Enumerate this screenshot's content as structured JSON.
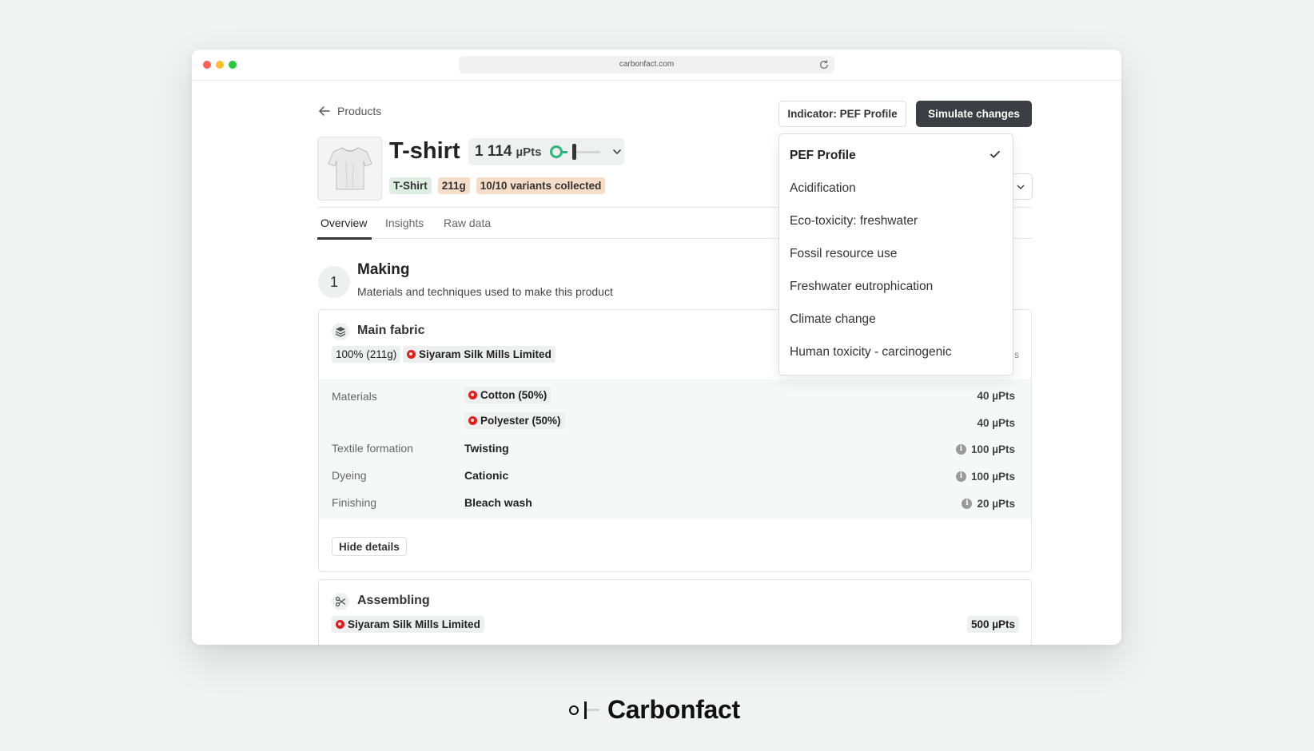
{
  "browser": {
    "url": "carbonfact.com"
  },
  "nav": {
    "back_label": "Products"
  },
  "toolbar": {
    "indicator_label": "Indicator: PEF Profile",
    "simulate_label": "Simulate changes"
  },
  "product": {
    "title": "T-shirt",
    "score": "1 114",
    "score_unit": "µPts",
    "score_level": 0.35,
    "tags": [
      "T-Shirt",
      "211g",
      "10/10 variants collected"
    ]
  },
  "tabs": [
    {
      "label": "Overview",
      "active": true
    },
    {
      "label": "Insights",
      "active": false
    },
    {
      "label": "Raw data",
      "active": false
    }
  ],
  "section": {
    "number": "1",
    "title": "Making",
    "subtitle": "Materials and techniques used to make this product"
  },
  "main_fabric": {
    "title": "Main fabric",
    "share": "100% (211g)",
    "supplier": "Siyaram Silk Mills Limited",
    "rows": [
      {
        "label": "Materials",
        "value": "Cotton (50%)",
        "pts": "40 µPts"
      },
      {
        "label": "",
        "value": "Polyester (50%)",
        "pts": "40 µPts"
      },
      {
        "label": "Textile formation",
        "value": "Twisting",
        "pts": "100 µPts"
      },
      {
        "label": "Dyeing",
        "value": "Cationic",
        "pts": "100 µPts"
      },
      {
        "label": "Finishing",
        "value": "Bleach wash",
        "pts": "20 µPts"
      }
    ],
    "hide_label": "Hide details"
  },
  "assembling": {
    "title": "Assembling",
    "supplier": "Siyaram Silk Mills Limited",
    "pts": "500 µPts"
  },
  "dropdown": {
    "items": [
      {
        "label": "PEF Profile",
        "selected": true
      },
      {
        "label": "Acidification",
        "selected": false
      },
      {
        "label": "Eco-toxicity: freshwater",
        "selected": false
      },
      {
        "label": "Fossil resource use",
        "selected": false
      },
      {
        "label": "Freshwater eutrophication",
        "selected": false
      },
      {
        "label": "Climate change",
        "selected": false
      },
      {
        "label": "Human toxicity - carcinogenic",
        "selected": false
      }
    ]
  },
  "brand": {
    "name": "Carbonfact"
  },
  "colors": {
    "accent_green": "#2fb67f",
    "dark_button": "#3b3e42",
    "flag_red": "#e01e1e",
    "tag_green": "#dfeee2",
    "tag_peach": "#f6ddc8"
  }
}
